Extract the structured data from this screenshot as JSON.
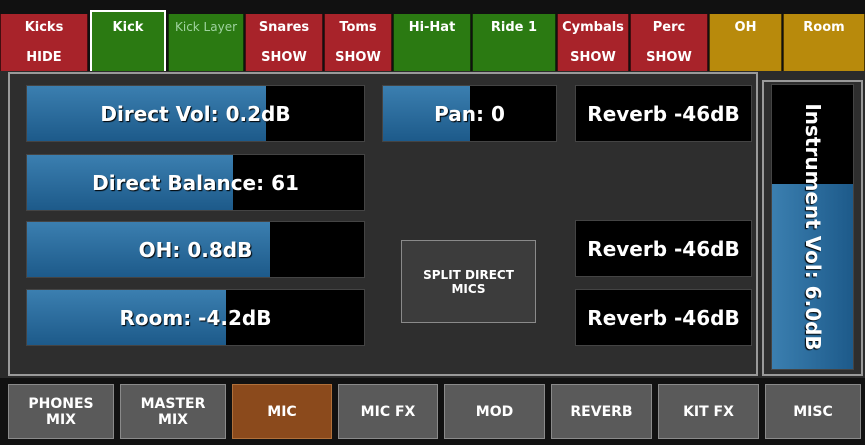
{
  "top_tabs": [
    {
      "line1": "Kicks",
      "line2": "HIDE",
      "color": "#a8232a"
    },
    {
      "line1": "Kick",
      "line2": "",
      "color": "#2b7a12",
      "selected": true
    },
    {
      "line1": "Kick Layer",
      "line2": "",
      "color": "#2b7a12"
    },
    {
      "line1": "Snares",
      "line2": "SHOW",
      "color": "#a8232a"
    },
    {
      "line1": "Toms",
      "line2": "SHOW",
      "color": "#a8232a"
    },
    {
      "line1": "Hi-Hat",
      "line2": "",
      "color": "#2b7a12"
    },
    {
      "line1": "Ride 1",
      "line2": "",
      "color": "#2b7a12"
    },
    {
      "line1": "Cymbals",
      "line2": "SHOW",
      "color": "#a8232a"
    },
    {
      "line1": "Perc",
      "line2": "SHOW",
      "color": "#a8232a"
    },
    {
      "line1": "OH",
      "line2": "",
      "color": "#b88a0c"
    },
    {
      "line1": "Room",
      "line2": "",
      "color": "#b88a0c"
    }
  ],
  "faders": {
    "direct_vol": {
      "label": "Direct Vol: 0.2dB",
      "level": 0.71
    },
    "direct_balance": {
      "label": "Direct Balance: 61",
      "level": 0.61
    },
    "oh": {
      "label": "OH: 0.8dB",
      "level": 0.72
    },
    "room": {
      "label": "Room: -4.2dB",
      "level": 0.59
    },
    "pan": {
      "label": "Pan: 0",
      "level": 0.5
    },
    "reverb_1": {
      "label": "Reverb -46dB",
      "level": 0.0
    },
    "reverb_2": {
      "label": "Reverb -46dB",
      "level": 0.0
    },
    "reverb_3": {
      "label": "Reverb -46dB",
      "level": 0.0
    }
  },
  "split_button": {
    "line1": "SPLIT DIRECT",
    "line2": "MICS"
  },
  "instrument_fader": {
    "label": "Instrument Vol: 6.0dB",
    "level": 0.65
  },
  "bottom_tabs": [
    {
      "line1": "PHONES",
      "line2": "MIX"
    },
    {
      "line1": "MASTER",
      "line2": "MIX"
    },
    {
      "line1": "MIC",
      "line2": "",
      "active": true
    },
    {
      "line1": "MIC FX",
      "line2": ""
    },
    {
      "line1": "MOD",
      "line2": ""
    },
    {
      "line1": "REVERB",
      "line2": ""
    },
    {
      "line1": "KIT FX",
      "line2": ""
    },
    {
      "line1": "MISC",
      "line2": ""
    }
  ]
}
